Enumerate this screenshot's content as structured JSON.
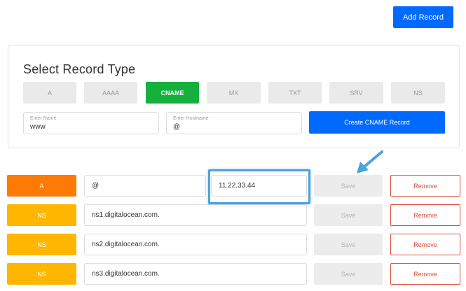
{
  "header": {
    "add_record_label": "Add Record"
  },
  "panel": {
    "title": "Select Record Type",
    "record_types": [
      {
        "label": "A",
        "active": false
      },
      {
        "label": "AAAA",
        "active": false
      },
      {
        "label": "CNAME",
        "active": true
      },
      {
        "label": "MX",
        "active": false
      },
      {
        "label": "TXT",
        "active": false
      },
      {
        "label": "SRV",
        "active": false
      },
      {
        "label": "NS",
        "active": false
      }
    ],
    "name_field": {
      "label": "Enter Name",
      "value": "www"
    },
    "hostname_field": {
      "label": "Enter Hostname",
      "value": "@"
    },
    "create_label": "Create CNAME Record"
  },
  "records": [
    {
      "type": "A",
      "name": "@",
      "value": "11.22.33.44",
      "save_label": "Save",
      "remove_label": "Remove"
    },
    {
      "type": "NS",
      "value": "ns1.digitalocean.com.",
      "save_label": "Save",
      "remove_label": "Remove"
    },
    {
      "type": "NS",
      "value": "ns2.digitalocean.com.",
      "save_label": "Save",
      "remove_label": "Remove"
    },
    {
      "type": "NS",
      "value": "ns3.digitalocean.com.",
      "save_label": "Save",
      "remove_label": "Remove"
    }
  ],
  "colors": {
    "primary_blue": "#0069ff",
    "active_green": "#15b03e",
    "a_record_orange": "#ff7a05",
    "ns_record_yellow": "#ffb600",
    "remove_red": "#e34b3a",
    "annotation_blue": "#4aa3df"
  },
  "annotations": {
    "arrow_icon": "arrow-pointing-down-left",
    "highlighted_field": "records.0.value"
  }
}
